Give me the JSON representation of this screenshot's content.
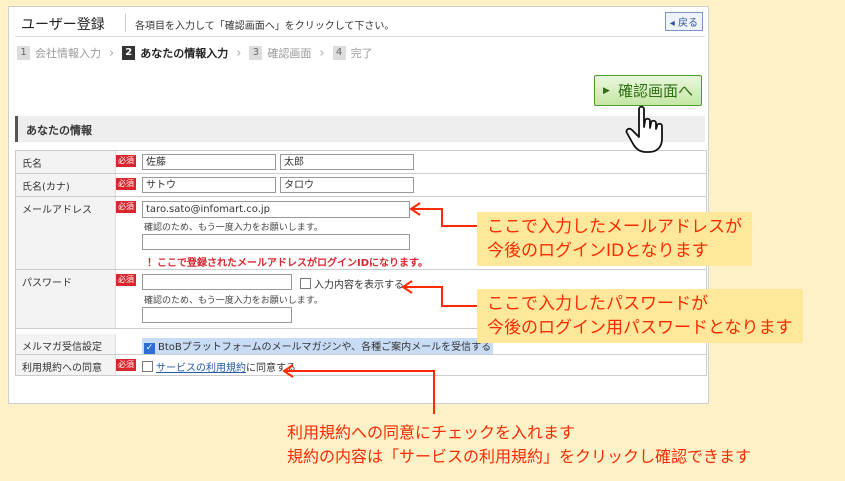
{
  "header": {
    "title": "ユーザー登録",
    "note": "各項目を入力して「確認画面へ」をクリックして下さい。",
    "back": "◂ 戻る"
  },
  "steps": [
    {
      "num": "1",
      "label": "会社情報入力"
    },
    {
      "num": "2",
      "label": "あなたの情報入力"
    },
    {
      "num": "3",
      "label": "確認画面"
    },
    {
      "num": "4",
      "label": "完了"
    }
  ],
  "confirm_button": "確認画面へ",
  "section_title": "あなたの情報",
  "required": "必須",
  "form": {
    "name_label": "氏名",
    "last_name": "佐藤",
    "first_name": "太郎",
    "kana_label": "氏名(カナ)",
    "last_kana": "サトウ",
    "first_kana": "タロウ",
    "email_label": "メールアドレス",
    "email": "taro.sato@infomart.co.jp",
    "confirm_hint": "確認のため、もう一度入力をお願いします。",
    "login_warning": "！ここで登録されたメールアドレスがログインIDになります。",
    "password_label": "パスワード",
    "show_password": "入力内容を表示する",
    "newsletter_label": "メルマガ受信設定",
    "newsletter_option": "BtoBプラットフォームのメールマガジンや、各種ご案内メールを受信する",
    "terms_label": "利用規約への同意",
    "terms_link": "サービスの利用規約",
    "terms_suffix": "に同意する"
  },
  "callouts": {
    "email_1": "ここで入力したメールアドレスが",
    "email_2": "今後のログインIDとなります",
    "password_1": "ここで入力したパスワードが",
    "password_2": "今後のログイン用パスワードとなります",
    "terms_1": "利用規約への同意にチェックを入れます",
    "terms_2": "規約の内容は「サービスの利用規約」をクリックし確認できます"
  },
  "colors": {
    "accent_red": "#ff2a00",
    "callout_bg": "#ffe89c",
    "required_bg": "#d8262c",
    "confirm_green": "#2f6e13"
  }
}
